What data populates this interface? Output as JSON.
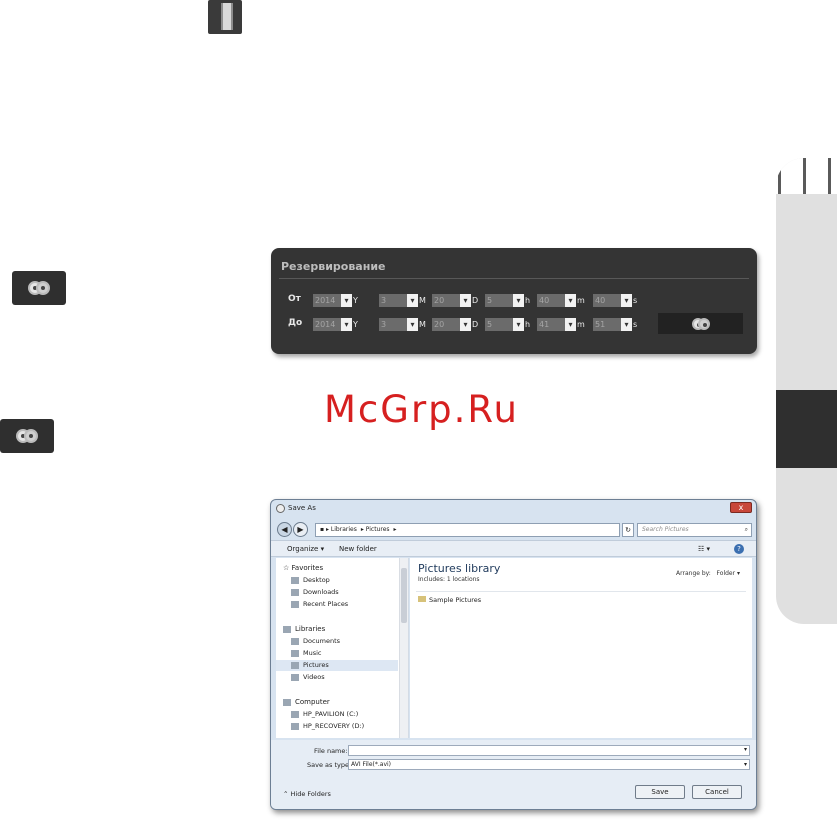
{
  "reservation": {
    "title": "Резервирование",
    "from_label": "От",
    "to_label": "До",
    "from": {
      "year": "2014",
      "month": "3",
      "day": "20",
      "hour": "5",
      "minute": "40",
      "second": "40"
    },
    "to": {
      "year": "2014",
      "month": "3",
      "day": "20",
      "hour": "5",
      "minute": "41",
      "second": "51"
    },
    "units": {
      "year": "Y",
      "month": "M",
      "day": "D",
      "hour": "h",
      "minute": "m",
      "second": "s"
    },
    "arrow": "▾"
  },
  "watermark": "McGrp.Ru",
  "save_dialog": {
    "title": "Save As",
    "close": "x",
    "breadcrumb": [
      "Libraries",
      "Pictures"
    ],
    "search_placeholder": "Search Pictures",
    "toolbar": {
      "organize": "Organize ▾",
      "new_folder": "New folder",
      "views": "☷ ▾",
      "help": "?"
    },
    "nav": {
      "favorites": "Favorites",
      "favorites_items": [
        "Desktop",
        "Downloads",
        "Recent Places"
      ],
      "libraries": "Libraries",
      "libraries_items": [
        "Documents",
        "Music",
        "Pictures",
        "Videos"
      ],
      "computer": "Computer",
      "computer_items": [
        "HP_PAVILION (C:)",
        "HP_RECOVERY (D:)"
      ]
    },
    "library_title": "Pictures library",
    "library_includes": "Includes:  1 locations",
    "arrange_by_label": "Arrange by:",
    "arrange_by_value": "Folder ▾",
    "folders": [
      "Sample Pictures"
    ],
    "file_name_label": "File name:",
    "file_name_value": "",
    "save_type_label": "Save as type:",
    "save_type_value": "AVI File(*.avi)",
    "hide_folders": "Hide Folders",
    "save_button": "Save",
    "cancel_button": "Cancel"
  }
}
